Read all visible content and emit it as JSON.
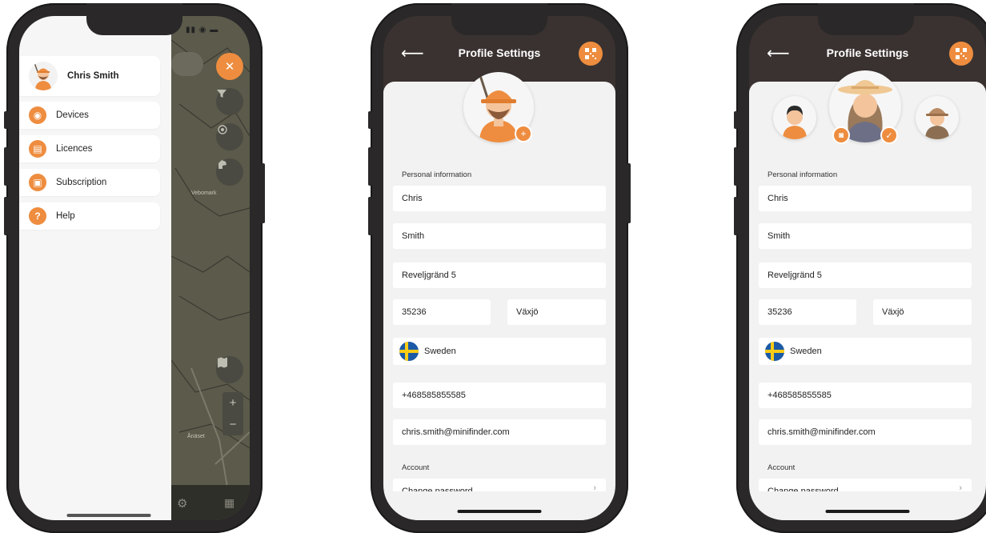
{
  "colors": {
    "accent": "#ee8d3f",
    "header": "#3a3230",
    "phone": "#2a2828"
  },
  "menu": {
    "user_name": "Chris Smith",
    "items": [
      {
        "label": "Devices",
        "icon": "devices-icon"
      },
      {
        "label": "Licences",
        "icon": "licences-icon"
      },
      {
        "label": "Subscription",
        "icon": "subscription-icon"
      },
      {
        "label": "Help",
        "icon": "help-icon"
      }
    ],
    "map_labels": [
      "Vebomark",
      "Ånäset"
    ]
  },
  "profile_screens": [
    {
      "title": "Profile Settings",
      "personal_label": "Personal information",
      "first_name": "Chris",
      "last_name": "Smith",
      "address": "Reveljgränd 5",
      "postal_code": "35236",
      "city": "Växjö",
      "country": "Sweden",
      "phone": "+468585855585",
      "email": "chris.smith@minifinder.com",
      "account_label": "Account",
      "change_password": "Change password"
    },
    {
      "title": "Profile Settings",
      "personal_label": "Personal information",
      "first_name": "Chris",
      "last_name": "Smith",
      "address": "Reveljgränd 5",
      "postal_code": "35236",
      "city": "Växjö",
      "country": "Sweden",
      "phone": "+468585855585",
      "email": "chris.smith@minifinder.com",
      "account_label": "Account",
      "change_password": "Change password"
    }
  ]
}
